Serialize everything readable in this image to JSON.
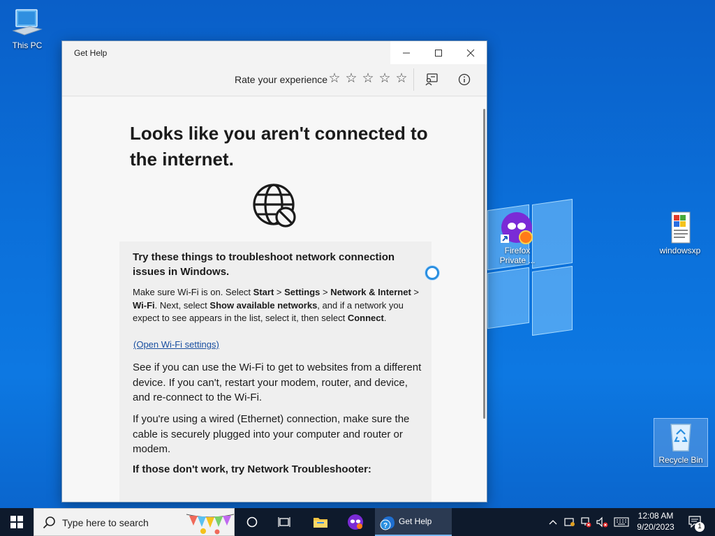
{
  "desktop": {
    "icons": [
      {
        "label": "This PC"
      },
      {
        "label": "Firefox Private ..."
      },
      {
        "label": "windowsxp"
      },
      {
        "label": "Recycle Bin"
      }
    ]
  },
  "window": {
    "title": "Get Help",
    "toolbar": {
      "rate_label": "Rate your experience",
      "stars_total": 5,
      "stars_selected": 0
    },
    "headline": "Looks like you aren't connected to the internet.",
    "card": {
      "title": "Try these things to troubleshoot network connection issues in Windows.",
      "p1_a": "Make sure Wi-Fi is on. Select ",
      "p1_start": "Start",
      "p1_b": " > ",
      "p1_settings": "Settings",
      "p1_c": " > ",
      "p1_network": "Network & Internet",
      "p1_d": " > ",
      "p1_wifi": "Wi-Fi",
      "p1_e": ". Next, select ",
      "p1_show": "Show available networks",
      "p1_f": ", and if a network you expect to see appears in the list, select it, then select ",
      "p1_connect": "Connect",
      "p1_g": ".",
      "link": "(Open Wi-Fi settings)",
      "p2": "See if you can use the Wi-Fi to get to websites from a different device. If you can't, restart your modem, router, and device, and re-connect to the Wi-Fi.",
      "p3": "If you're using a wired (Ethernet) connection, make sure the cable is securely plugged into your computer and router or modem.",
      "p4": "If those don't work, try Network Troubleshooter:"
    }
  },
  "taskbar": {
    "search_placeholder": "Type here to search",
    "active_app": "Get Help",
    "clock_time": "12:08 AM",
    "clock_date": "9/20/2023",
    "notification_count": "1"
  }
}
